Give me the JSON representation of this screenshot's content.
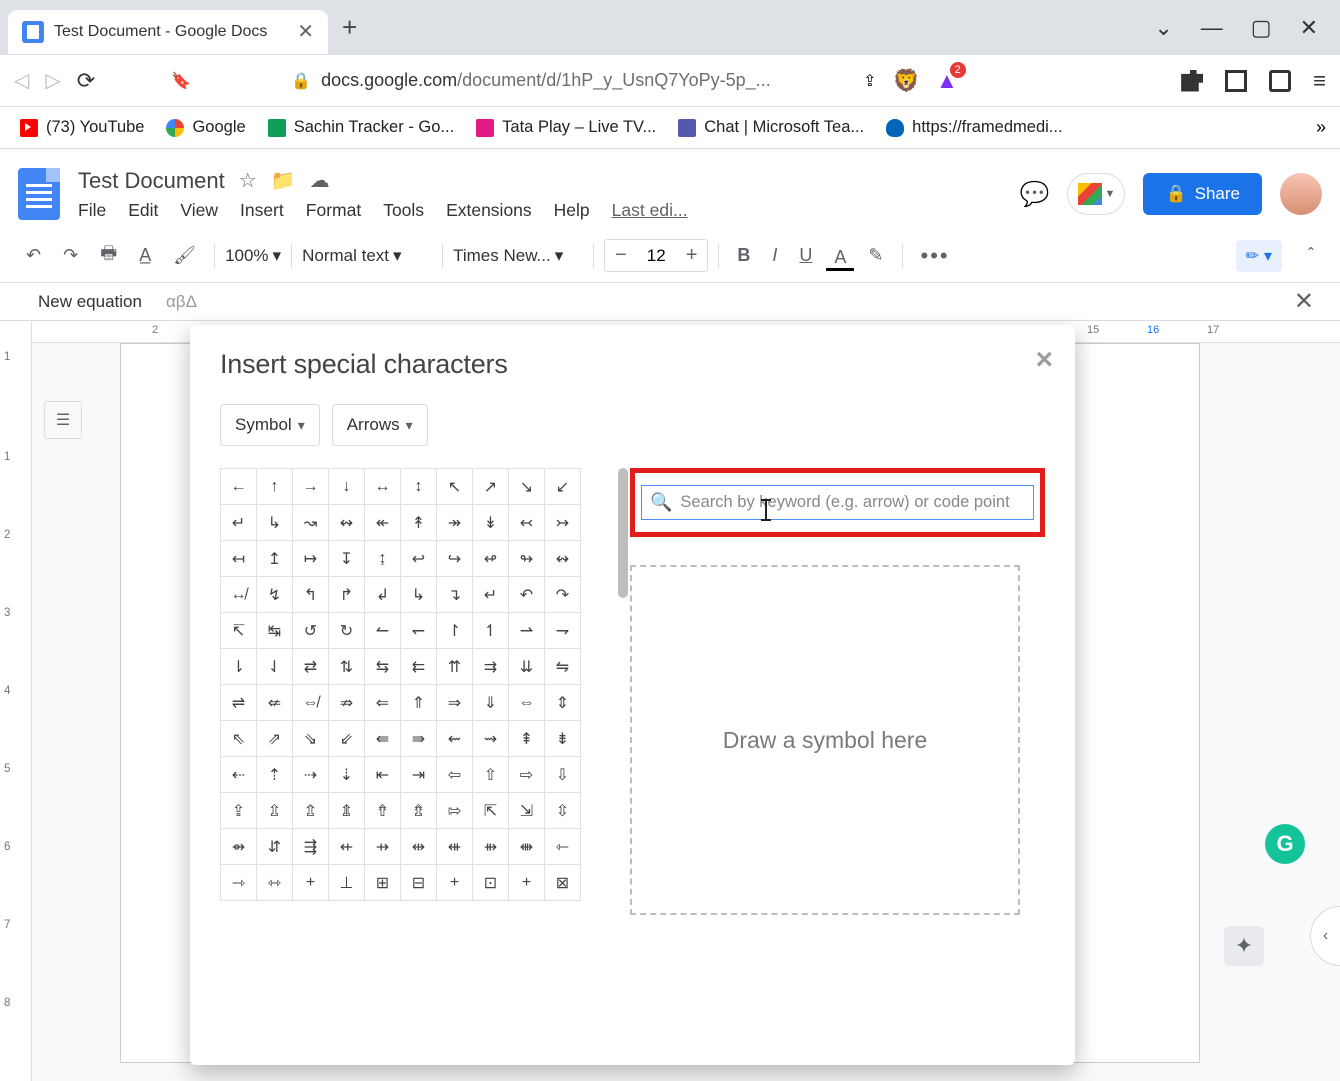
{
  "browser": {
    "tab_title": "Test Document - Google Docs",
    "url_host": "docs.google.com",
    "url_path": "/document/d/1hP_y_UsnQ7YoPy-5p_...",
    "notification_count": "2"
  },
  "bookmarks": [
    {
      "label": "(73) YouTube"
    },
    {
      "label": "Google"
    },
    {
      "label": "Sachin Tracker - Go..."
    },
    {
      "label": "Tata Play – Live TV..."
    },
    {
      "label": "Chat | Microsoft Tea..."
    },
    {
      "label": "https://framedmedi..."
    }
  ],
  "doc": {
    "title": "Test Document",
    "menus": [
      "File",
      "Edit",
      "View",
      "Insert",
      "Format",
      "Tools",
      "Extensions",
      "Help"
    ],
    "last_edit": "Last edi...",
    "share": "Share"
  },
  "toolbar": {
    "zoom": "100%",
    "style": "Normal text",
    "font": "Times New...",
    "size": "12"
  },
  "equation_bar": {
    "label": "New equation",
    "greek": "αβΔ"
  },
  "ruler_h_marks": [
    "2",
    "15",
    "16",
    "17"
  ],
  "ruler_v_marks": [
    "1",
    "1",
    "2",
    "3",
    "4",
    "5",
    "6",
    "7",
    "8"
  ],
  "modal": {
    "title": "Insert special characters",
    "cat1": "Symbol",
    "cat2": "Arrows",
    "search_placeholder": "Search by keyword (e.g. arrow) or code point",
    "draw_hint": "Draw a symbol here",
    "grid": [
      [
        "←",
        "↑",
        "→",
        "↓",
        "↔",
        "↕",
        "↖",
        "↗",
        "↘",
        "↙"
      ],
      [
        "↵",
        "↳",
        "↝",
        "↭",
        "↞",
        "↟",
        "↠",
        "↡",
        "↢",
        "↣"
      ],
      [
        "↤",
        "↥",
        "↦",
        "↧",
        "↨",
        "↩",
        "↪",
        "↫",
        "↬",
        "↭"
      ],
      [
        "↮",
        "↯",
        "↰",
        "↱",
        "↲",
        "↳",
        "↴",
        "↵",
        "↶",
        "↷"
      ],
      [
        "↸",
        "↹",
        "↺",
        "↻",
        "↼",
        "↽",
        "↾",
        "↿",
        "⇀",
        "⇁"
      ],
      [
        "⇂",
        "⇃",
        "⇄",
        "⇅",
        "⇆",
        "⇇",
        "⇈",
        "⇉",
        "⇊",
        "⇋"
      ],
      [
        "⇌",
        "⇍",
        "⇎",
        "⇏",
        "⇐",
        "⇑",
        "⇒",
        "⇓",
        "⇔",
        "⇕"
      ],
      [
        "⇖",
        "⇗",
        "⇘",
        "⇙",
        "⇚",
        "⇛",
        "⇜",
        "⇝",
        "⇞",
        "⇟"
      ],
      [
        "⇠",
        "⇡",
        "⇢",
        "⇣",
        "⇤",
        "⇥",
        "⇦",
        "⇧",
        "⇨",
        "⇩"
      ],
      [
        "⇪",
        "⇫",
        "⇬",
        "⇭",
        "⇮",
        "⇯",
        "⇰",
        "⇱",
        "⇲",
        "⇳"
      ],
      [
        "⇴",
        "⇵",
        "⇶",
        "⇷",
        "⇸",
        "⇹",
        "⇺",
        "⇻",
        "⇼",
        "⇽"
      ],
      [
        "⇾",
        "⇿",
        "+",
        "⊥",
        "⊞",
        "⊟",
        "+",
        "⊡",
        "+",
        "⊠"
      ]
    ]
  }
}
